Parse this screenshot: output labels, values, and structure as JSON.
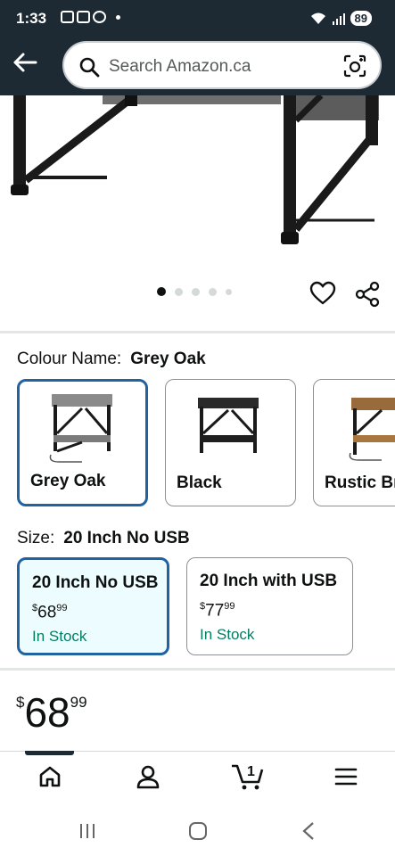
{
  "status": {
    "time": "1:33",
    "battery": "89"
  },
  "search": {
    "placeholder": "Search Amazon.ca"
  },
  "colour": {
    "label": "Colour Name:",
    "selected": "Grey Oak",
    "options": [
      "Grey Oak",
      "Black",
      "Rustic Br"
    ]
  },
  "size": {
    "label": "Size:",
    "selected": "20 Inch No USB",
    "options": [
      {
        "title": "20 Inch No USB",
        "currency": "$",
        "whole": "68",
        "cents": "99",
        "stock": "In Stock"
      },
      {
        "title": "20 Inch with USB",
        "currency": "$",
        "whole": "77",
        "cents": "99",
        "stock": "In Stock"
      }
    ]
  },
  "price": {
    "currency": "$",
    "whole": "68",
    "cents": "99"
  },
  "cart_count": "1",
  "colors": {
    "header": "#1d2933",
    "selected_border": "#2162a1",
    "in_stock": "#067d62"
  }
}
